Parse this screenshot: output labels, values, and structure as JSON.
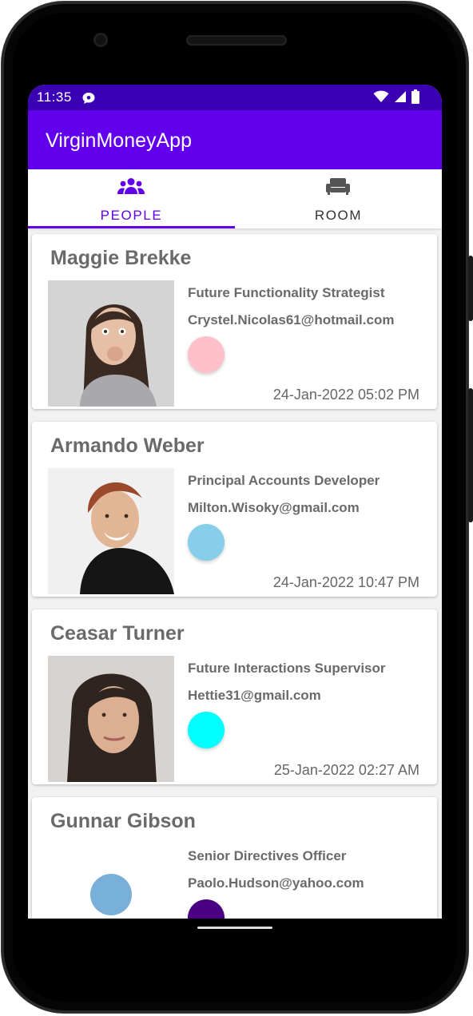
{
  "status_bar": {
    "time": "11:35"
  },
  "app_bar": {
    "title": "VirginMoneyApp"
  },
  "tabs": [
    {
      "label": "PEOPLE",
      "icon": "people-icon",
      "selected": true
    },
    {
      "label": "ROOM",
      "icon": "sofa-icon",
      "selected": false
    }
  ],
  "colors": {
    "accent": "#6200ee",
    "status": "#3c00b4"
  },
  "people": [
    {
      "name": "Maggie Brekke",
      "job_title": "Future Functionality Strategist",
      "email": "Crystel.Nicolas61@hotmail.com",
      "color": "#ffc0cb",
      "date": "24-Jan-2022 05:02 PM"
    },
    {
      "name": "Armando Weber",
      "job_title": "Principal Accounts Developer",
      "email": "Milton.Wisoky@gmail.com",
      "color": "#87ceeb",
      "date": "24-Jan-2022 10:47 PM"
    },
    {
      "name": "Ceasar Turner",
      "job_title": "Future Interactions Supervisor",
      "email": "Hettie31@gmail.com",
      "color": "#00ffff",
      "date": "25-Jan-2022 02:27 AM"
    },
    {
      "name": "Gunnar Gibson",
      "job_title": "Senior Directives Officer",
      "email": "Paolo.Hudson@yahoo.com",
      "color": "#4b0082",
      "date": ""
    }
  ]
}
